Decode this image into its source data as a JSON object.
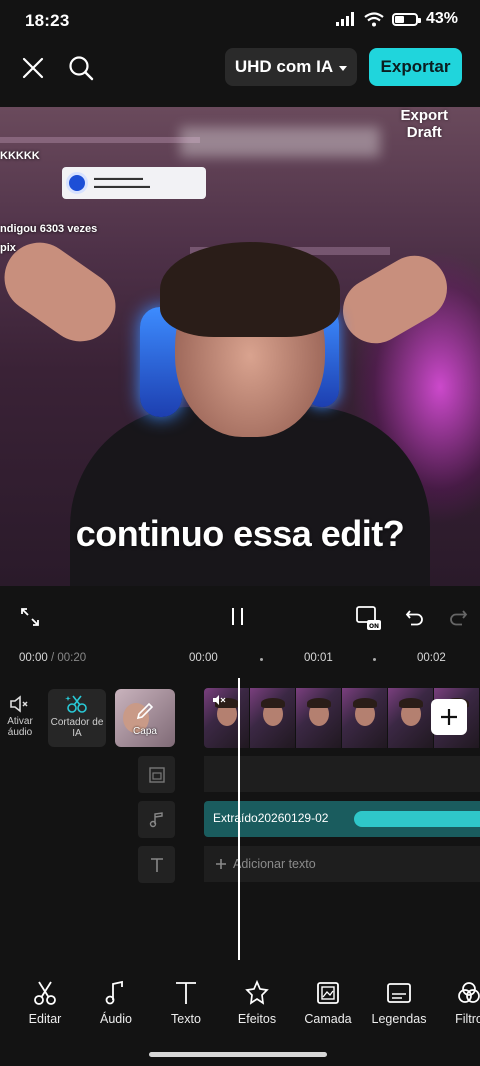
{
  "status": {
    "time": "18:23",
    "battery": "43%"
  },
  "topbar": {
    "quality": "UHD com IA",
    "export_label": "Exportar"
  },
  "preview": {
    "watermark_line1": "Export",
    "watermark_line2": "Draft",
    "caption": "continuo essa edit?",
    "overlay_text_1": "KKKKK",
    "overlay_text_2": "ndigou 6303 vezes",
    "overlay_text_3": "pix"
  },
  "ruler": {
    "current": "00:00",
    "total": "/ 00:20",
    "ticks": [
      "00:00",
      "00:01",
      "00:02"
    ]
  },
  "timeline": {
    "mute_label": "Ativar áudio",
    "ai_cut_label": "Cortador de IA",
    "cover_label": "Capa",
    "audio_clip": "Extraído20260129-02",
    "add_text": "Adicionar texto"
  },
  "toolbar": {
    "items": [
      {
        "label": "Editar",
        "icon": "scissors-icon"
      },
      {
        "label": "Áudio",
        "icon": "music-note-icon"
      },
      {
        "label": "Texto",
        "icon": "text-icon"
      },
      {
        "label": "Efeitos",
        "icon": "sparkle-star-icon"
      },
      {
        "label": "Camada",
        "icon": "layer-image-icon"
      },
      {
        "label": "Legendas",
        "icon": "captions-icon"
      },
      {
        "label": "Filtro",
        "icon": "filter-circles-icon"
      }
    ]
  },
  "colors": {
    "accent": "#20d5dc",
    "background": "#131313",
    "audio_track": "#1a5c5e"
  }
}
